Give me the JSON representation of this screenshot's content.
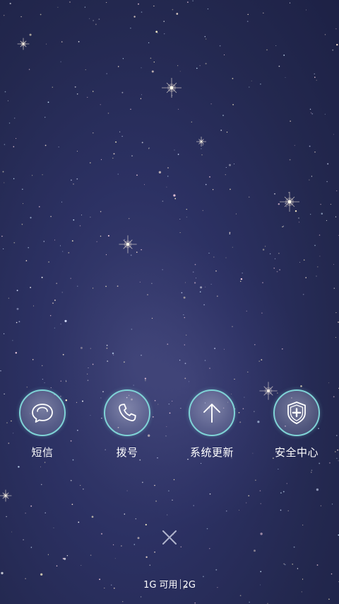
{
  "shortcuts": [
    {
      "label": "短信",
      "icon": "message-icon"
    },
    {
      "label": "拨号",
      "icon": "phone-icon"
    },
    {
      "label": "系统更新",
      "icon": "arrow-up-icon"
    },
    {
      "label": "安全中心",
      "icon": "shield-plus-icon"
    }
  ],
  "close": {
    "icon": "close-icon"
  },
  "network": {
    "used": "1G 可用",
    "total": "2G"
  },
  "colors": {
    "ring": "#7fd3d6",
    "background": "#2c3163",
    "text": "#ffffff"
  }
}
